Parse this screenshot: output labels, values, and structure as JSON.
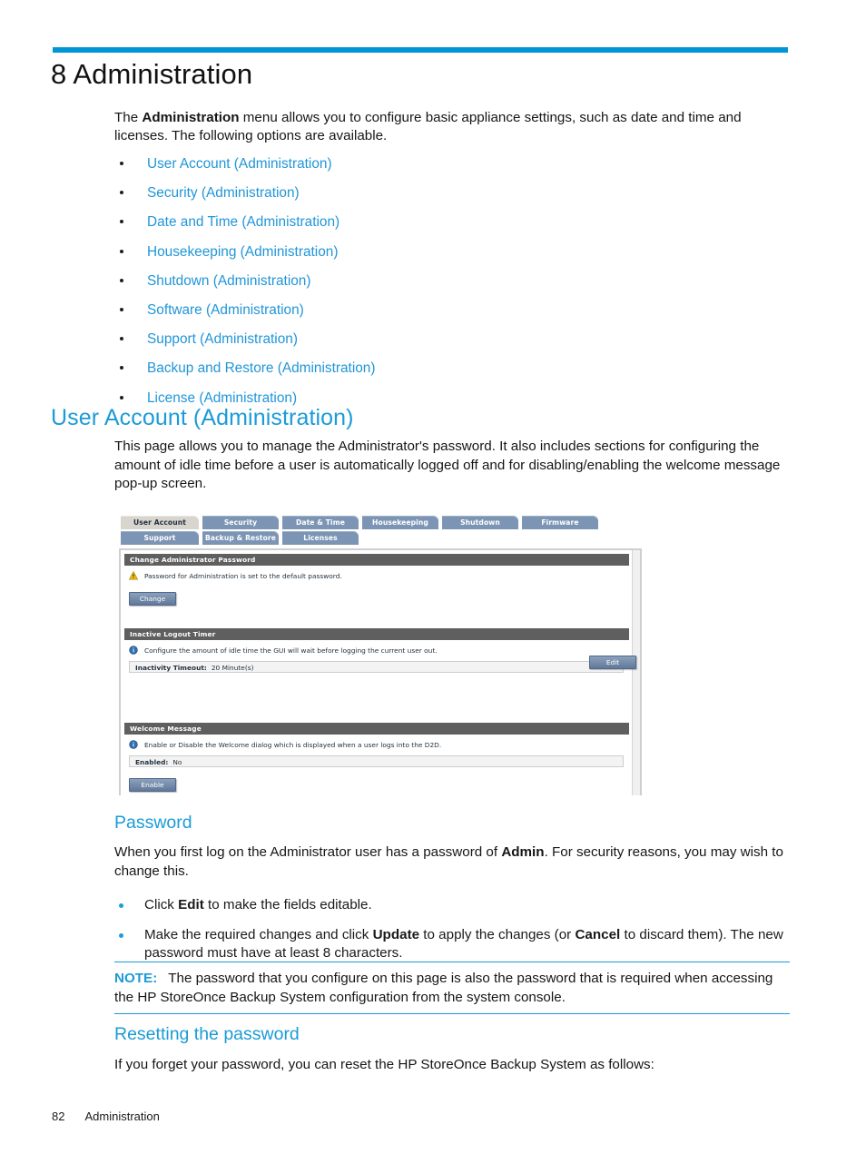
{
  "document": {
    "chapter_title": "8 Administration",
    "accent_color": "#0096d6",
    "link_color": "#2196d8"
  },
  "intro": {
    "lead_pre": "The ",
    "lead_bold": "Administration",
    "lead_post": " menu allows you to configure basic appliance settings, such as date and time and licenses. The following options are available."
  },
  "toc_links": [
    {
      "label": "User Account (Administration)"
    },
    {
      "label": "Security (Administration)"
    },
    {
      "label": "Date and Time (Administration)"
    },
    {
      "label": "Housekeeping (Administration)"
    },
    {
      "label": "Shutdown (Administration)"
    },
    {
      "label": "Software (Administration)"
    },
    {
      "label": "Support (Administration)"
    },
    {
      "label": "Backup and Restore (Administration)"
    },
    {
      "label": "License (Administration)"
    }
  ],
  "user_account_section": {
    "heading": "User Account (Administration)",
    "body": "This page allows you to manage the Administrator's password. It also includes sections for configuring the amount of idle time before a user is automatically logged off and for disabling/enabling the welcome message pop-up screen."
  },
  "screenshot": {
    "tabs_row1": [
      {
        "label": "User Account",
        "active": true
      },
      {
        "label": "Security",
        "active": false
      },
      {
        "label": "Date & Time",
        "active": false
      },
      {
        "label": "Housekeeping",
        "active": false
      },
      {
        "label": "Shutdown",
        "active": false
      },
      {
        "label": "Firmware",
        "active": false
      }
    ],
    "tabs_row2": [
      {
        "label": "Support",
        "active": false
      },
      {
        "label": "Backup & Restore",
        "active": false
      },
      {
        "label": "Licenses",
        "active": false
      }
    ],
    "groups": {
      "change_password": {
        "title": "Change Administrator Password",
        "message": "Password for Administration is set to the default password.",
        "icon": "warning-icon",
        "button": "Change"
      },
      "inactive_logout": {
        "title": "Inactive Logout Timer",
        "message": "Configure the amount of idle time the GUI will wait before logging the current user out.",
        "icon": "info-icon",
        "field_label": "Inactivity Timeout:",
        "field_value": "20 Minute(s)",
        "button": "Edit"
      },
      "welcome_message": {
        "title": "Welcome Message",
        "message": "Enable or Disable the Welcome dialog which is displayed when a user logs into the D2D.",
        "icon": "info-icon",
        "field_label": "Enabled:",
        "field_value": "No",
        "button": "Enable"
      }
    }
  },
  "password_section": {
    "heading": "Password",
    "intro_pre": "When you first log on the Administrator user has a password of ",
    "intro_bold": "Admin",
    "intro_post": ". For security reasons, you may wish to change this.",
    "steps": [
      {
        "pre": "Click ",
        "bold1": "Edit",
        "mid": " to make the fields editable.",
        "bold2": "",
        "post": ""
      },
      {
        "pre": "Make the required changes and click ",
        "bold1": "Update",
        "mid": " to apply the changes (or ",
        "bold2": "Cancel",
        "post": " to discard them). The new password must have at least 8 characters."
      }
    ]
  },
  "note": {
    "label": "NOTE:",
    "text": "The password that you configure on this page is also the password that is required when accessing the HP StoreOnce Backup System configuration from the system console."
  },
  "resetting_section": {
    "heading": "Resetting the password",
    "body": "If you forget your password, you can reset the HP StoreOnce Backup System as follows:"
  },
  "footer": {
    "page_number": "82",
    "chapter_name": "Administration"
  }
}
